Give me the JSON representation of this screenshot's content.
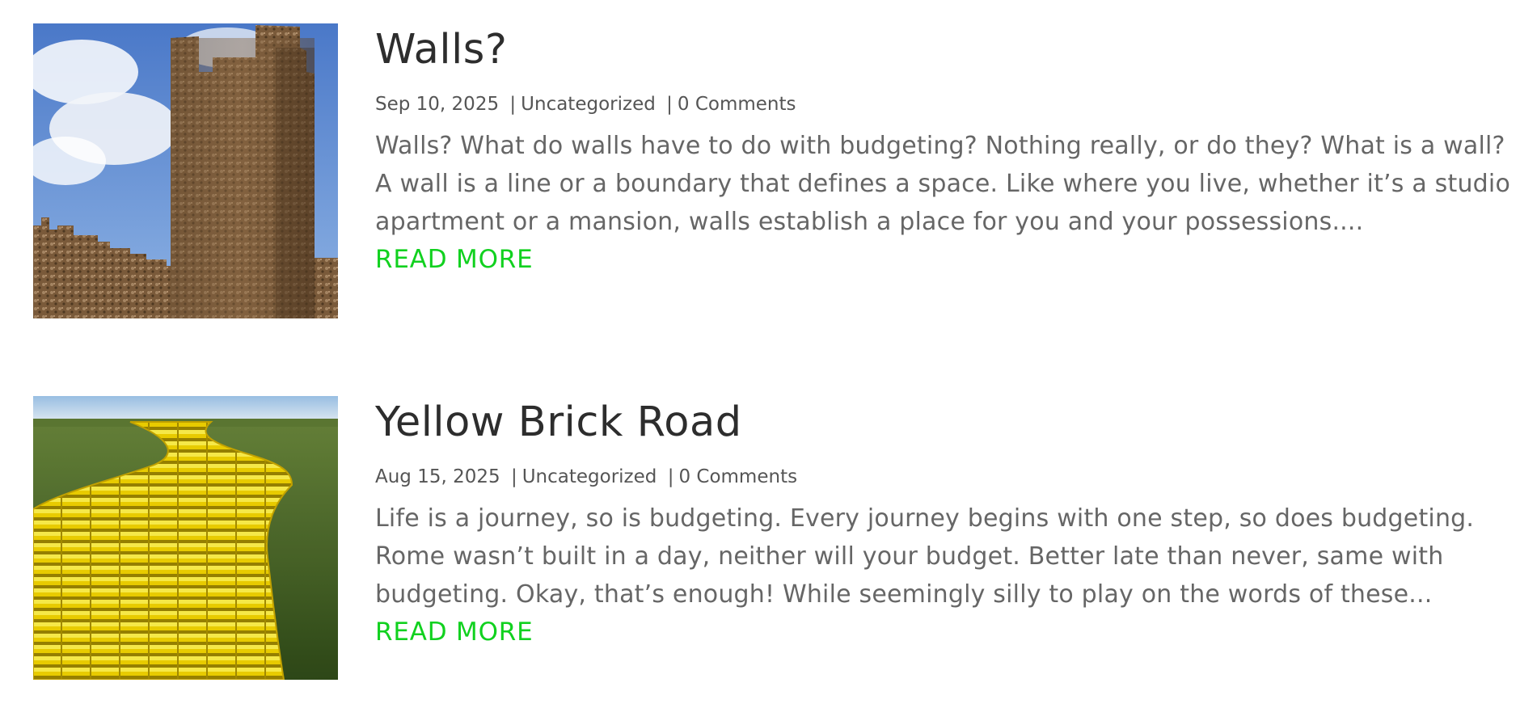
{
  "posts": [
    {
      "title": "Walls?",
      "date": "Sep 10, 2025",
      "category": "Uncategorized",
      "comments": "0 Comments",
      "separator": "|",
      "excerpt": "Walls? What do walls have to do with budgeting? Nothing really, or do they? What is a wall? A wall is a line or a boundary that defines a space. Like where you live, whether it’s a studio apartment or a mansion, walls establish a place for you and your possessions....",
      "read_more": "READ MORE",
      "thumbnail_icon": "castle-tower-image"
    },
    {
      "title": "Yellow Brick Road",
      "date": "Aug 15, 2025",
      "category": "Uncategorized",
      "comments": "0 Comments",
      "separator": "|",
      "excerpt": "Life is a journey, so is budgeting. Every journey begins with one step, so does budgeting. Rome wasn’t built in a day, neither will your budget. Better late than never, same with budgeting. Okay, that’s enough! While seemingly silly to play on the words of these...",
      "read_more": "READ MORE",
      "thumbnail_icon": "yellow-brick-road-image"
    }
  ],
  "colors": {
    "title": "#2d2d2d",
    "meta": "#555555",
    "excerpt": "#666666",
    "read_more": "#11d11f"
  }
}
